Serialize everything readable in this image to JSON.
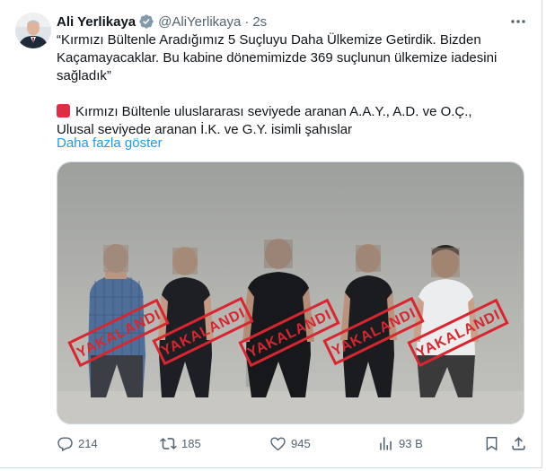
{
  "author": {
    "name": "Ali Yerlikaya",
    "handle": "@AliYerlikaya",
    "separator": "·",
    "time": "2s"
  },
  "tweet": {
    "paragraph1": "“Kırmızı Bültenle Aradığımız 5 Suçluyu Daha Ülkemize Getirdik. Bizden Kaçamayacaklar. Bu kabine  dönemimizde 369 suçlunun ülkemize iadesini sağladık”",
    "paragraph2_line1": "Kırmızı Bültenle uluslararası seviyede aranan A.A.Y., A.D. ve O.Ç.,",
    "paragraph2_line2": "Ulusal seviyede aranan İ.K. ve G.Y. isimli şahıslar",
    "show_more": "Daha fazla göster"
  },
  "media": {
    "stamp_text": "YAKALANDI",
    "stamp_color": "#d9262e"
  },
  "actions": {
    "replies": "214",
    "retweets": "185",
    "likes": "945",
    "views": "93 B"
  },
  "colors": {
    "text": "#0f1419",
    "secondary": "#536471",
    "link": "#1d9bf0",
    "verified": "#829aab",
    "border": "#cfd9de"
  },
  "icons": [
    "verified-badge-icon",
    "more-icon",
    "reply-icon",
    "retweet-icon",
    "like-icon",
    "views-icon",
    "bookmark-icon",
    "share-icon",
    "red-square-icon"
  ]
}
